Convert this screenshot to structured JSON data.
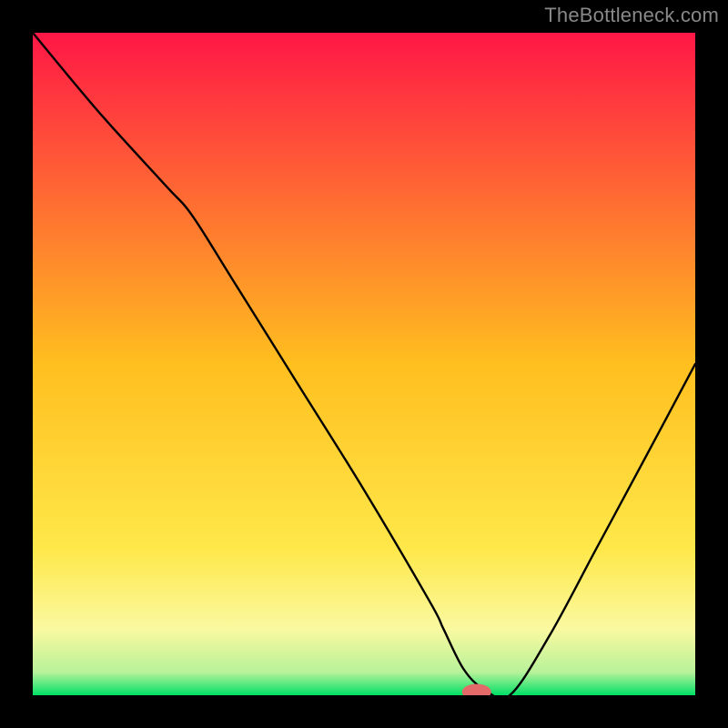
{
  "watermark": "TheBottleneck.com",
  "chart_data": {
    "type": "line",
    "title": "",
    "xlabel": "",
    "ylabel": "",
    "xlim": [
      0,
      100
    ],
    "ylim": [
      0,
      100
    ],
    "legend": false,
    "grid": false,
    "background_gradient_stops": [
      {
        "offset": 0.0,
        "color": "#ff1746"
      },
      {
        "offset": 0.5,
        "color": "#ffbf1f"
      },
      {
        "offset": 0.78,
        "color": "#ffe84a"
      },
      {
        "offset": 0.9,
        "color": "#faf9a0"
      },
      {
        "offset": 0.965,
        "color": "#b8f29a"
      },
      {
        "offset": 1.0,
        "color": "#00e066"
      }
    ],
    "series": [
      {
        "name": "bottleneck-curve",
        "x": [
          0,
          10,
          20,
          24,
          30,
          40,
          50,
          60,
          62,
          65,
          68,
          72,
          78,
          85,
          92,
          100
        ],
        "values": [
          100,
          88,
          77,
          72.5,
          63,
          47,
          31,
          14,
          10,
          4,
          1,
          0,
          9,
          22,
          35,
          50
        ]
      }
    ],
    "marker": {
      "name": "optimum-marker",
      "x": 67,
      "y": 0.5,
      "rx_pct": 2.2,
      "ry_pct": 1.2,
      "fill": "#e46a6a"
    }
  }
}
